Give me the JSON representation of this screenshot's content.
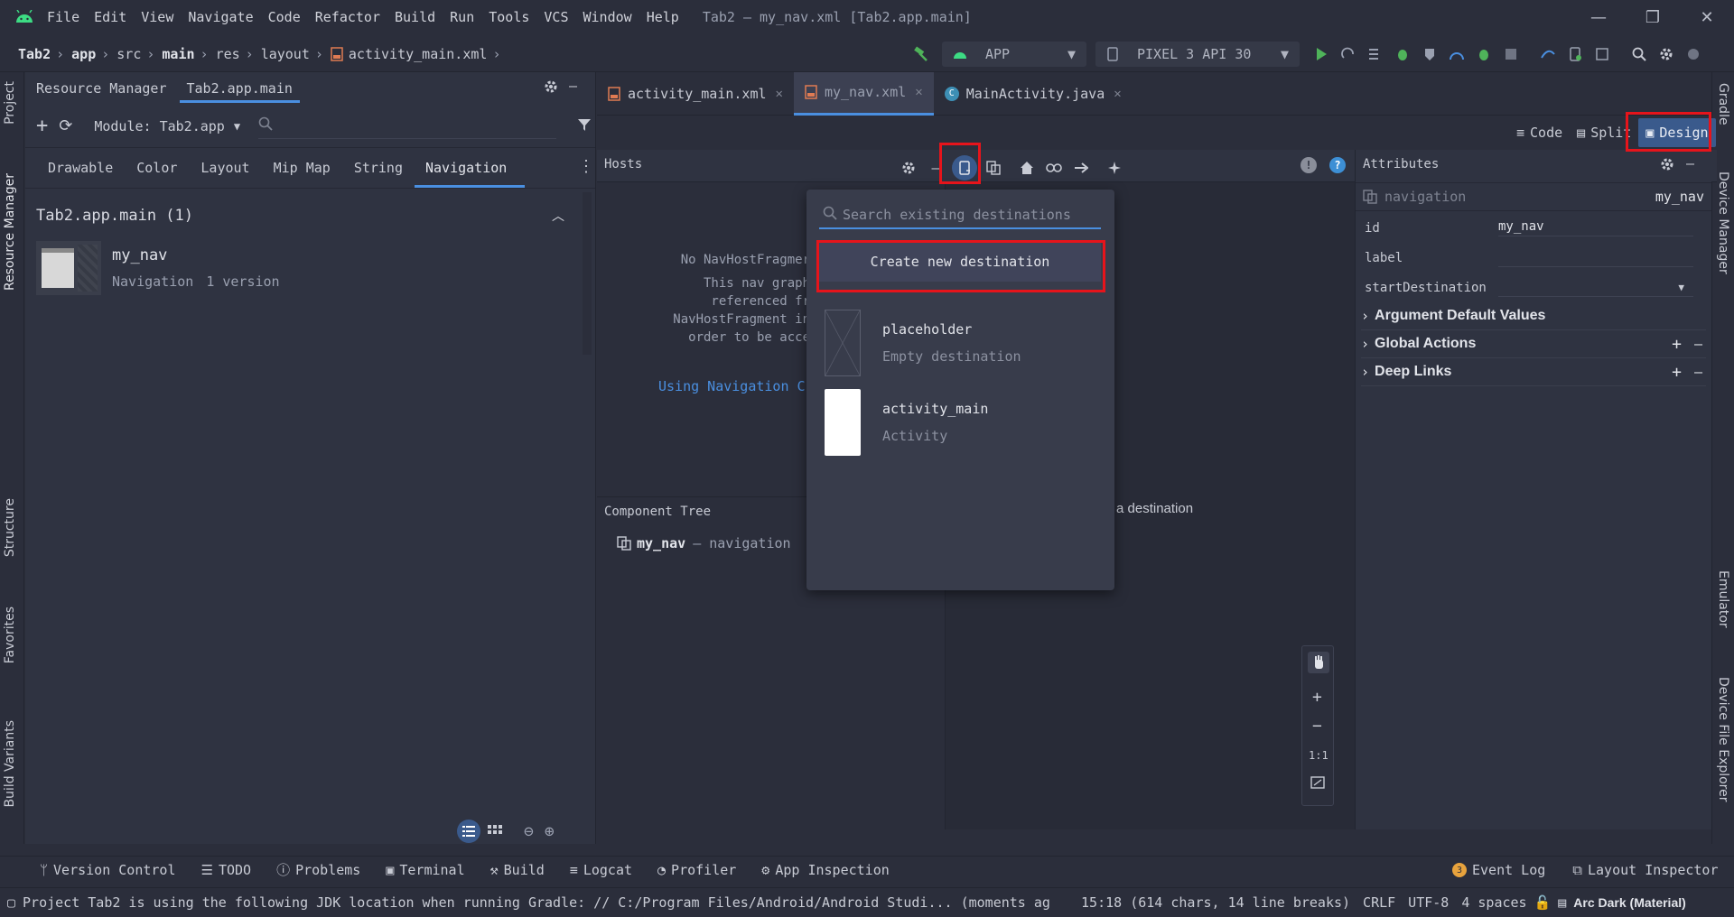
{
  "titlebar": {
    "menu": [
      "File",
      "Edit",
      "View",
      "Navigate",
      "Code",
      "Refactor",
      "Build",
      "Run",
      "Tools",
      "VCS",
      "Window",
      "Help"
    ],
    "window_title": "Tab2 – my_nav.xml [Tab2.app.main]"
  },
  "navbar": {
    "breadcrumb": [
      "Tab2",
      "app",
      "src",
      "main",
      "res",
      "layout",
      "activity_main.xml"
    ],
    "run_config": "APP",
    "device": "PIXEL 3 API 30"
  },
  "left_stripe": [
    "Project",
    "Resource Manager",
    "Structure",
    "Favorites",
    "Build Variants"
  ],
  "right_stripe": [
    "Gradle",
    "Device Manager",
    "Emulator",
    "Device File Explorer"
  ],
  "resource_manager": {
    "tabs": [
      "Resource Manager",
      "Tab2.app.main"
    ],
    "module": "Module: Tab2.app",
    "categories": [
      "Drawable",
      "Color",
      "Layout",
      "Mip Map",
      "String",
      "Navigation"
    ],
    "group_title": "Tab2.app.main (1)",
    "item_name": "my_nav",
    "item_type": "Navigation",
    "item_versions": "1 version"
  },
  "editor": {
    "tabs": [
      "activity_main.xml",
      "my_nav.xml",
      "MainActivity.java"
    ],
    "modes": [
      "Code",
      "Split",
      "Design"
    ],
    "hosts_label": "Hosts",
    "host_msg": [
      "No NavHostFragmer",
      "This nav graph",
      "referenced fr",
      "NavHostFragment in",
      "order to be acce"
    ],
    "host_link": "Using Navigation C",
    "component_tree": "Component Tree",
    "tree_item": "my_nav",
    "tree_item_type": "– navigation",
    "canvas_hint": "a destination",
    "zoom": [
      "1:1"
    ]
  },
  "popup": {
    "search_placeholder": "Search existing destinations",
    "create_label": "Create new destination",
    "destinations": [
      {
        "name": "placeholder",
        "sub": "Empty destination"
      },
      {
        "name": "activity_main",
        "sub": "Activity"
      }
    ]
  },
  "attributes": {
    "title": "Attributes",
    "component": "navigation",
    "component_id": "my_nav",
    "rows": [
      {
        "key": "id",
        "value": "my_nav"
      },
      {
        "key": "label",
        "value": ""
      },
      {
        "key": "startDestination",
        "value": ""
      }
    ],
    "sections": [
      "Argument Default Values",
      "Global Actions",
      "Deep Links"
    ]
  },
  "bottom_tools": [
    "Version Control",
    "TODO",
    "Problems",
    "Terminal",
    "Build",
    "Logcat",
    "Profiler",
    "App Inspection"
  ],
  "bottom_right": {
    "event_log": "Event Log",
    "event_count": "3",
    "layout_inspector": "Layout Inspector"
  },
  "status": {
    "message": "Project Tab2 is using the following JDK location when running Gradle: // C:/Program Files/Android/Android Studi... (moments ag",
    "position": "15:18 (614 chars, 14 line breaks)",
    "line_sep": "CRLF",
    "encoding": "UTF-8",
    "indent": "4 spaces",
    "theme": "Arc Dark (Material)"
  },
  "colors": {
    "accent": "#4a8fe0",
    "highlight": "#e6141b",
    "android_green": "#3ddc84"
  }
}
